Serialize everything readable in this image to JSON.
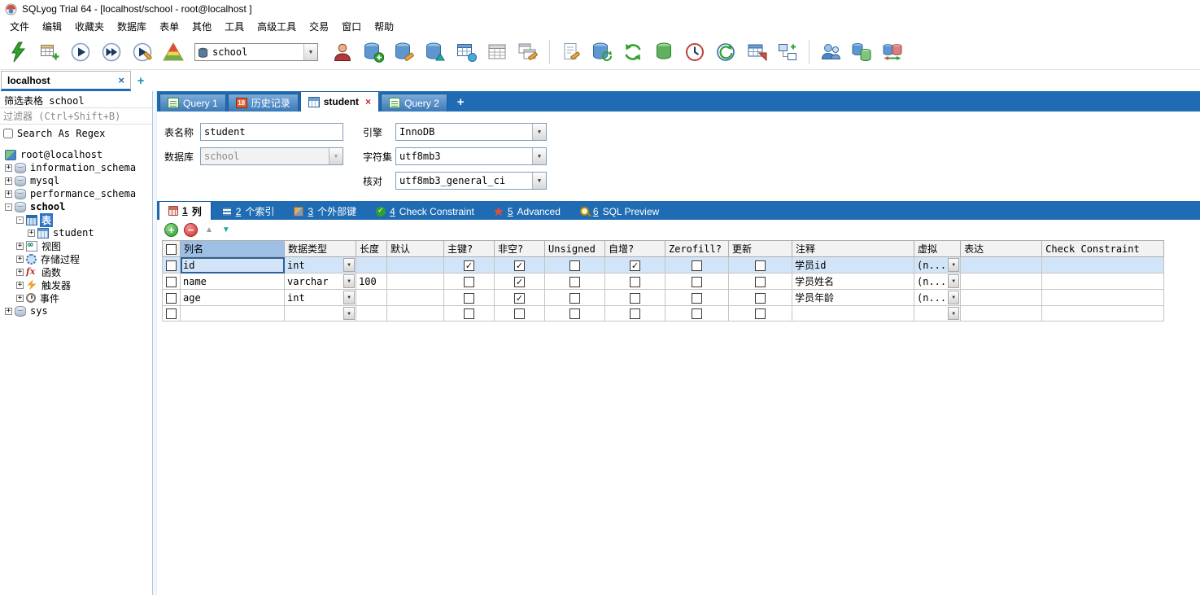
{
  "window": {
    "title": "SQLyog Trial 64 - [localhost/school - root@localhost ]"
  },
  "menubar": {
    "items": [
      "文件",
      "编辑",
      "收藏夹",
      "数据库",
      "表单",
      "其他",
      "工具",
      "高级工具",
      "交易",
      "窗口",
      "帮助"
    ]
  },
  "toolbar": {
    "database_select_value": "school",
    "icon_names": [
      "connect",
      "new-query-tab",
      "execute-query",
      "execute-all-queries",
      "explain-query",
      "query-profiler",
      "user-manager",
      "create-database",
      "alter-database",
      "manage-indexes",
      "create-table",
      "alter-table",
      "table-data",
      "new-schema-file",
      "refresh-database",
      "refresh-object-browser",
      "backup-database",
      "query-history",
      "scheduled-backup",
      "query-builder",
      "schema-designer",
      "manage-users",
      "copy-database",
      "sync-database"
    ]
  },
  "connection_bar": {
    "tab_label": "localhost",
    "close_glyph": "×",
    "add_glyph": "+"
  },
  "sidebar": {
    "filter_table_text": "筛选表格 school",
    "filter_placeholder": "过滤器 (Ctrl+Shift+B)",
    "regex_label": "Search As Regex",
    "tree_items": [
      {
        "label": "root@localhost",
        "expander": ""
      },
      {
        "label": "information_schema",
        "expander": "+"
      },
      {
        "label": "mysql",
        "expander": "+"
      },
      {
        "label": "performance_schema",
        "expander": "+"
      },
      {
        "label": "school",
        "expander": "-"
      },
      {
        "label": "表",
        "expander": "-"
      },
      {
        "label": "student",
        "expander": "+"
      },
      {
        "label": "视图",
        "expander": "+"
      },
      {
        "label": "存储过程",
        "expander": "+"
      },
      {
        "label": "函数",
        "expander": "+"
      },
      {
        "label": "触发器",
        "expander": "+"
      },
      {
        "label": "事件",
        "expander": "+"
      },
      {
        "label": "sys",
        "expander": "+"
      }
    ]
  },
  "query_tabs": {
    "tabs": [
      {
        "label": "Query 1"
      },
      {
        "label": "历史记录",
        "badge": "18"
      },
      {
        "label": "student",
        "close_glyph": "×"
      },
      {
        "label": "Query 2"
      }
    ],
    "add_glyph": "+"
  },
  "table_form": {
    "table_name_label": "表名称",
    "table_name_value": "student",
    "database_label": "数据库",
    "database_value": "school",
    "engine_label": "引擎",
    "engine_value": "InnoDB",
    "charset_label": "字符集",
    "charset_value": "utf8mb3",
    "collation_label": "核对",
    "collation_value": "utf8mb3_general_ci"
  },
  "designer_tabs": [
    {
      "num": "1",
      "text": "列"
    },
    {
      "num": "2",
      "text": "个索引"
    },
    {
      "num": "3",
      "text": "个外部键"
    },
    {
      "num": "4",
      "text": "Check Constraint"
    },
    {
      "num": "5",
      "text": "Advanced"
    },
    {
      "num": "6",
      "text": "SQL Preview"
    }
  ],
  "grid_toolbar": {
    "add": "+",
    "remove": "−",
    "up": "▲",
    "down": "▼"
  },
  "columns_grid": {
    "headers": [
      "列名",
      "数据类型",
      "长度",
      "默认",
      "主键?",
      "非空?",
      "Unsigned",
      "自增?",
      "Zerofill?",
      "更新",
      "注释",
      "虚拟",
      "表达",
      "Check Constraint"
    ],
    "rows": [
      {
        "name": "id",
        "datatype": "int",
        "length": "",
        "default": "",
        "pk": "✓",
        "not_null": "✓",
        "unsigned": "",
        "auto_increment": "✓",
        "zerofill": "",
        "update": "",
        "comment": "学员id",
        "virtual": "(n...",
        "expression": "",
        "check_constraint": ""
      },
      {
        "name": "name",
        "datatype": "varchar",
        "length": "100",
        "default": "",
        "pk": "",
        "not_null": "✓",
        "unsigned": "",
        "auto_increment": "",
        "zerofill": "",
        "update": "",
        "comment": "学员姓名",
        "virtual": "(n...",
        "expression": "",
        "check_constraint": ""
      },
      {
        "name": "age",
        "datatype": "int",
        "length": "",
        "default": "",
        "pk": "",
        "not_null": "✓",
        "unsigned": "",
        "auto_increment": "",
        "zerofill": "",
        "update": "",
        "comment": "学员年龄",
        "virtual": "(n...",
        "expression": "",
        "check_constraint": ""
      },
      {
        "name": "",
        "datatype": "",
        "length": "",
        "default": "",
        "pk": "",
        "not_null": "",
        "unsigned": "",
        "auto_increment": "",
        "zerofill": "",
        "update": "",
        "comment": "",
        "virtual": "",
        "expression": "",
        "check_constraint": ""
      }
    ]
  },
  "glyphs": {
    "dropdown": "▼",
    "dropdown_small": "▼"
  }
}
